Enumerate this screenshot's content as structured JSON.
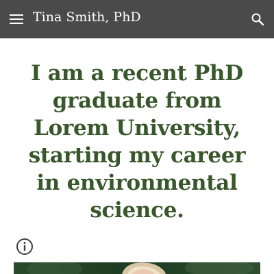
{
  "header": {
    "title": "Tina Smith, PhD",
    "menu_icon": "menu-icon",
    "search_icon": "search-icon",
    "background_color": "#4a4a4a"
  },
  "main": {
    "heading": "I am a recent PhD graduate from Lorem University, starting my career in environmental science.",
    "heading_color": "#38572b",
    "info_icon": "info-icon",
    "image": "portrait-photo"
  }
}
